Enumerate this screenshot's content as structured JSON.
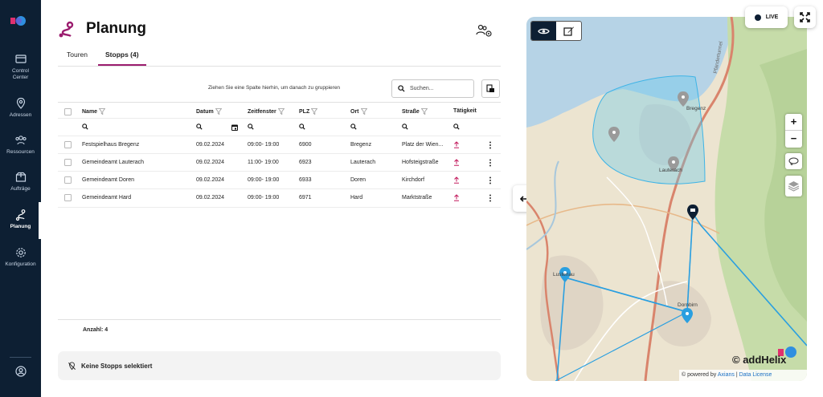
{
  "sidebar": {
    "items": [
      {
        "label": "Control Center",
        "line1": "Control",
        "line2": "Center",
        "icon": "monitor-icon"
      },
      {
        "label": "Adressen",
        "icon": "location-pin-icon"
      },
      {
        "label": "Ressourcen",
        "icon": "group-icon"
      },
      {
        "label": "Aufträge",
        "icon": "package-icon"
      },
      {
        "label": "Planung",
        "icon": "route-icon",
        "active": true
      },
      {
        "label": "Konfiguration",
        "icon": "gear-icon"
      }
    ],
    "profile_icon": "user-circle-icon"
  },
  "page": {
    "title": "Planung",
    "icon": "route-icon"
  },
  "tabs": [
    {
      "label": "Touren",
      "active": false
    },
    {
      "label": "Stopps (4)",
      "active": true
    }
  ],
  "toolbar": {
    "group_hint": "Ziehen Sie eine Spalte hierhin, um danach zu gruppieren",
    "search_placeholder": "Suchen...",
    "export_icon": "export-icon"
  },
  "table": {
    "columns": [
      "Name",
      "Datum",
      "Zeitfenster",
      "PLZ",
      "Ort",
      "Straße",
      "Tätigkeit"
    ],
    "rows": [
      {
        "name": "Festspielhaus Bregenz",
        "datum": "09.02.2024",
        "zeit": "09:00- 19:00",
        "plz": "6900",
        "ort": "Bregenz",
        "strasse": "Platz der Wien..."
      },
      {
        "name": "Gemeindeamt Lauterach",
        "datum": "09.02.2024",
        "zeit": "11:00- 19:00",
        "plz": "6923",
        "ort": "Lauterach",
        "strasse": "Hofsteigstraße"
      },
      {
        "name": "Gemeindeamt Doren",
        "datum": "09.02.2024",
        "zeit": "09:00- 19:00",
        "plz": "6933",
        "ort": "Doren",
        "strasse": "Kirchdorf"
      },
      {
        "name": "Gemeindeamt Hard",
        "datum": "09.02.2024",
        "zeit": "09:00- 19:00",
        "plz": "6971",
        "ort": "Hard",
        "strasse": "Marktstraße"
      }
    ],
    "count_label": "Anzahl: 4"
  },
  "status": {
    "text": "Keine Stopps selektiert"
  },
  "map": {
    "live_label": "LIVE",
    "brand": "© addHelix",
    "footer_prefix": "© powered by ",
    "footer_link1": "Axians",
    "footer_sep": " | ",
    "footer_link2": "Data License",
    "labels": {
      "bregenz": "Bregenz",
      "lauterach": "Lauterach",
      "lustenau": "Lustenau",
      "dornbirn": "Dornbirn",
      "tunnel": "Pfändertunnel"
    },
    "zoom_in": "+",
    "zoom_out": "−",
    "colors": {
      "route": "#2a9fe0",
      "area": "#5ec8ef",
      "accent": "#9b1c6e",
      "nav": "#0d1f33"
    }
  }
}
